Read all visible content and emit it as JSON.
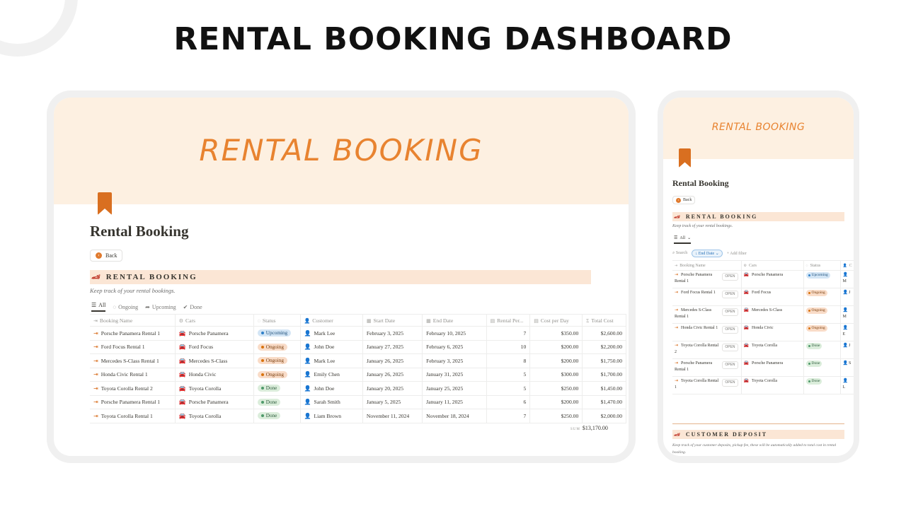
{
  "main_title": "RENTAL BOOKING DASHBOARD",
  "colors": {
    "accent": "#e88330",
    "cover": "#fdf0e1",
    "section_bar": "#fbe6d5",
    "bookmark": "#d96f20"
  },
  "desktop": {
    "cover_text": "RENTAL BOOKING",
    "page_title": "Rental Booking",
    "back_label": "Back",
    "section_title": "RENTAL BOOKING",
    "section_subtitle": "Keep track of your rental bookings.",
    "tabs": [
      {
        "label": "All",
        "icon": "list-icon"
      },
      {
        "label": "Ongoing",
        "icon": "spinner-icon"
      },
      {
        "label": "Upcoming",
        "icon": "forward-arrow-icon"
      },
      {
        "label": "Done",
        "icon": "check-circle-icon"
      }
    ],
    "columns": [
      "Booking Name",
      "Cars",
      "Status",
      "Customer",
      "Start Date",
      "End Date",
      "Rental Per...",
      "Cost per Day",
      "Total Cost"
    ],
    "rows": [
      {
        "name": "Porsche Panamera Rental 1",
        "car": "Porsche Panamera",
        "status": "Upcoming",
        "customer": "Mark Lee",
        "start": "February 3, 2025",
        "end": "February 10, 2025",
        "period": "7",
        "cost_day": "$350.00",
        "total": "$2,600.00"
      },
      {
        "name": "Ford Focus Rental 1",
        "car": "Ford Focus",
        "status": "Ongoing",
        "customer": "John Doe",
        "start": "January 27, 2025",
        "end": "February 6, 2025",
        "period": "10",
        "cost_day": "$200.00",
        "total": "$2,200.00"
      },
      {
        "name": "Mercedes S-Class Rental 1",
        "car": "Mercedes S-Class",
        "status": "Ongoing",
        "customer": "Mark Lee",
        "start": "January 26, 2025",
        "end": "February 3, 2025",
        "period": "8",
        "cost_day": "$200.00",
        "total": "$1,750.00"
      },
      {
        "name": "Honda Civic Rental 1",
        "car": "Honda Civic",
        "status": "Ongoing",
        "customer": "Emily Chen",
        "start": "January 26, 2025",
        "end": "January 31, 2025",
        "period": "5",
        "cost_day": "$300.00",
        "total": "$1,700.00"
      },
      {
        "name": "Toyota Corolla Rental 2",
        "car": "Toyota Corolla",
        "status": "Done",
        "customer": "John Doe",
        "start": "January 20, 2025",
        "end": "January 25, 2025",
        "period": "5",
        "cost_day": "$250.00",
        "total": "$1,450.00"
      },
      {
        "name": "Porsche Panamera Rental 1",
        "car": "Porsche Panamera",
        "status": "Done",
        "customer": "Sarah Smith",
        "start": "January 5, 2025",
        "end": "January 11, 2025",
        "period": "6",
        "cost_day": "$200.00",
        "total": "$1,470.00"
      },
      {
        "name": "Toyota Corolla Rental 1",
        "car": "Toyota Corolla",
        "status": "Done",
        "customer": "Liam Brown",
        "start": "November 11, 2024",
        "end": "November 18, 2024",
        "period": "7",
        "cost_day": "$250.00",
        "total": "$2,000.00"
      }
    ],
    "sum_label": "SUM",
    "sum_value": "$13,170.00"
  },
  "status_colors": {
    "Upcoming": {
      "bg": "#d3e5f5",
      "dot": "#2f80c9",
      "fg": "#1d4f7a"
    },
    "Ongoing": {
      "bg": "#f9dcc8",
      "dot": "#d9730d",
      "fg": "#7a3e0c"
    },
    "Done": {
      "bg": "#dbeddb",
      "dot": "#4f9a6a",
      "fg": "#2b5b3a"
    }
  },
  "mobile": {
    "cover_text": "RENTAL BOOKING",
    "page_title": "Rental Booking",
    "back_label": "Back",
    "section_title": "RENTAL BOOKING",
    "section_subtitle": "Keep track of your rental bookings.",
    "view_label": "All",
    "search_label": "Search",
    "filter_chip": "End Date",
    "add_filter": "+ Add filter",
    "columns": [
      "Booking Name",
      "Cars",
      "Status",
      "C"
    ],
    "open_label": "OPEN",
    "rows": [
      {
        "name": "Porsche Panamera Rental 1",
        "car": "Porsche Panamera",
        "status": "Upcoming",
        "cust": "M"
      },
      {
        "name": "Ford Focus Rental 1",
        "car": "Ford Focus",
        "status": "Ongoing",
        "cust": "J"
      },
      {
        "name": "Mercedes S-Class Rental 1",
        "car": "Mercedes S-Class",
        "status": "Ongoing",
        "cust": "M"
      },
      {
        "name": "Honda Civic Rental 1",
        "car": "Honda Civic",
        "status": "Ongoing",
        "cust": "E"
      },
      {
        "name": "Toyota Corolla Rental 2",
        "car": "Toyota Corolla",
        "status": "Done",
        "cust": "J"
      },
      {
        "name": "Porsche Panamera Rental 1",
        "car": "Porsche Panamera",
        "status": "Done",
        "cust": "S"
      },
      {
        "name": "Toyota Corolla Rental 1",
        "car": "Toyota Corolla",
        "status": "Done",
        "cust": "L"
      }
    ],
    "deposit_title": "CUSTOMER DEPOSIT",
    "deposit_subtitle": "Keep track of your customer deposits, pickup fee, these will be automatically added to total cost in rental booking."
  }
}
